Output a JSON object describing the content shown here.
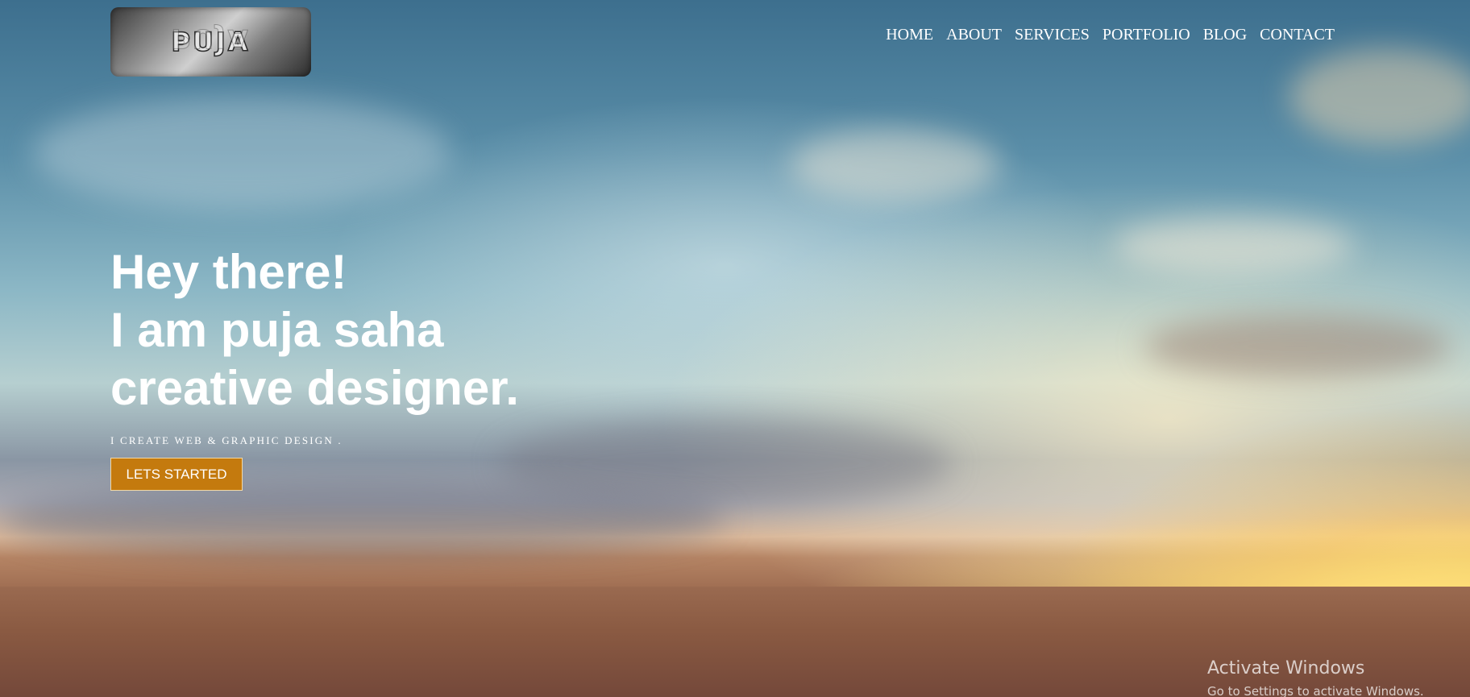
{
  "logo": {
    "text": "PUJA"
  },
  "nav": {
    "items": [
      {
        "label": "HOME"
      },
      {
        "label": "ABOUT"
      },
      {
        "label": "SERVICES"
      },
      {
        "label": "PORTFOLIO"
      },
      {
        "label": "BLOG"
      },
      {
        "label": "CONTACT"
      }
    ]
  },
  "hero": {
    "headline_line1": "Hey there!",
    "headline_line2": "I am puja saha",
    "headline_line3": "creative designer.",
    "tagline": "I CREATE WEB & GRAPHIC DESIGN .",
    "cta_label": "LETS STARTED",
    "cta_color": "#c47a0e"
  },
  "watermark": {
    "title": "Activate Windows",
    "subtitle": "Go to Settings to activate Windows."
  }
}
